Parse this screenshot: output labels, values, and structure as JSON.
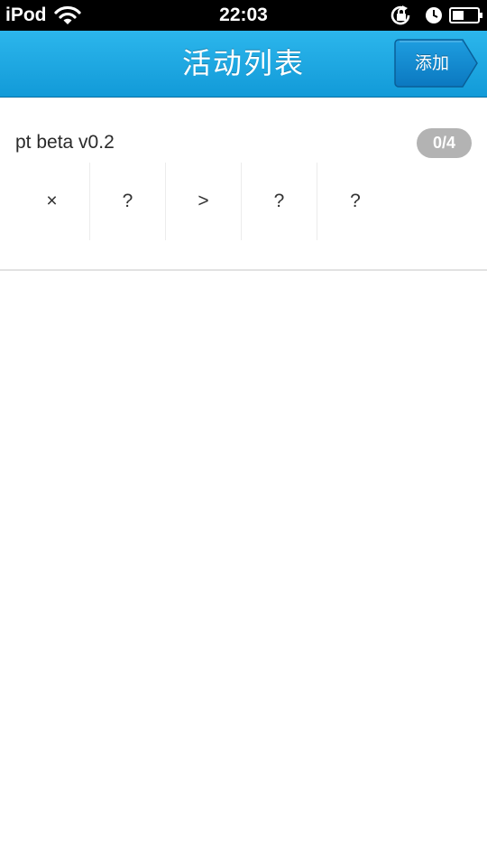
{
  "status_bar": {
    "carrier": "iPod",
    "time": "22:03"
  },
  "nav": {
    "title": "活动列表",
    "add_label": "添加"
  },
  "colors": {
    "nav_accent": "#1aa7e2",
    "badge": "#b3b3b3"
  },
  "activities": [
    {
      "title": "pt beta v0.2",
      "count": "0/4",
      "statuses": [
        "×",
        "?",
        ">",
        "?",
        "?"
      ]
    }
  ]
}
